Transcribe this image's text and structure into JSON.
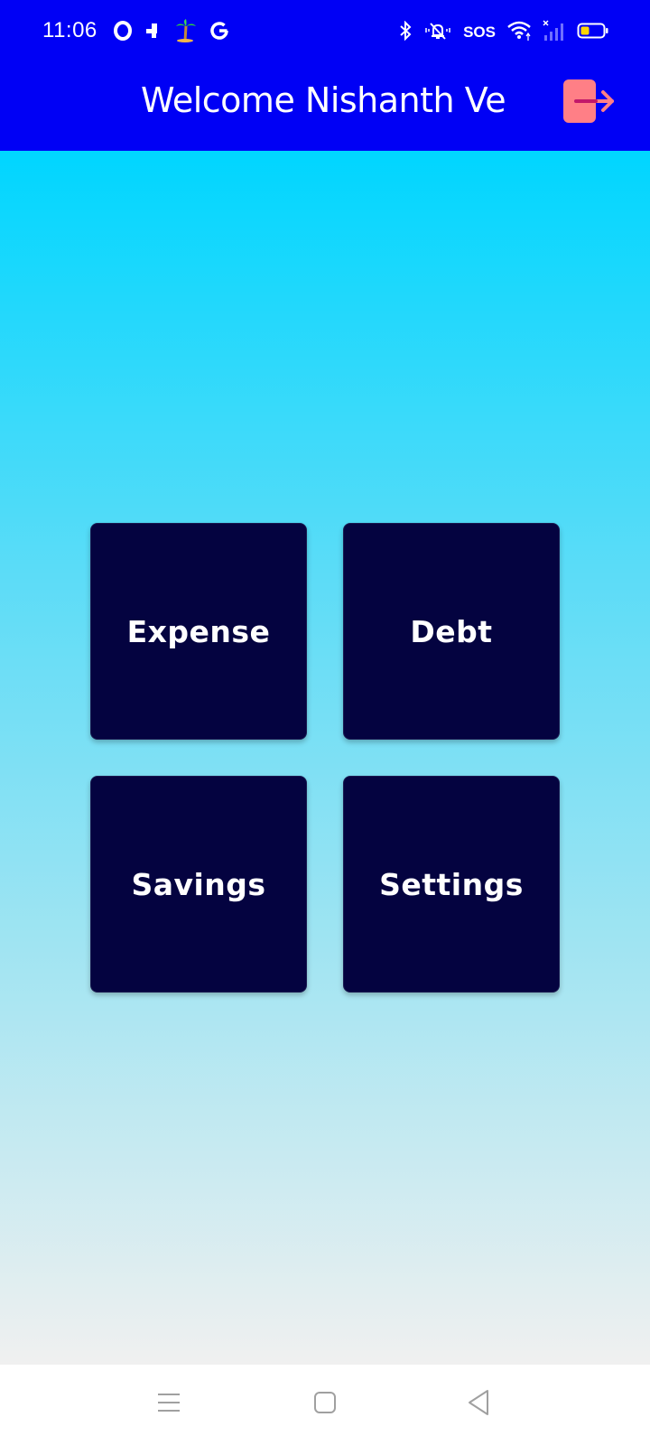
{
  "status_bar": {
    "time": "11:06",
    "sos": "SOS",
    "left_icons": [
      "opera-icon",
      "notification-app-icon",
      "palm-tree-icon",
      "google-icon"
    ],
    "right_icons": [
      "bluetooth-icon",
      "silent-icon",
      "wifi-icon",
      "signal-icon",
      "battery-icon"
    ]
  },
  "header": {
    "title": "Welcome Nishanth Ve",
    "logout_icon": "logout-icon",
    "logout_color": "#ff7f86"
  },
  "colors": {
    "header_bg": "#0000f5",
    "tile_bg": "#040340",
    "gradient_top": "#00d6ff",
    "gradient_bottom": "#f0f0f0"
  },
  "tiles": [
    {
      "label": "Expense"
    },
    {
      "label": "Debt"
    },
    {
      "label": "Savings"
    },
    {
      "label": "Settings"
    }
  ],
  "nav_bar": {
    "icons": [
      "menu-icon",
      "home-square-icon",
      "back-triangle-icon"
    ]
  }
}
